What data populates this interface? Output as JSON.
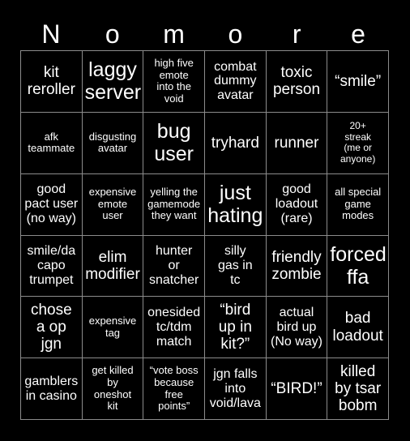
{
  "card": {
    "title_letters": [
      "N",
      "o",
      "m",
      "o",
      "r",
      "e"
    ],
    "columns": 6,
    "rows": 6,
    "colors": {
      "background": "#000000",
      "text": "#ffffff",
      "grid_line": "#8c8c8c"
    },
    "cells": [
      {
        "text": "kit\nreroller",
        "size": "lg"
      },
      {
        "text": "laggy\nserver",
        "size": "xl"
      },
      {
        "text": "high five\nemote\ninto the\nvoid",
        "size": "sm"
      },
      {
        "text": "combat\ndummy\navatar",
        "size": "md"
      },
      {
        "text": "toxic\nperson",
        "size": "lg"
      },
      {
        "text": "“smile”",
        "size": "lg"
      },
      {
        "text": "afk\nteammate",
        "size": "sm"
      },
      {
        "text": "disgusting\navatar",
        "size": "sm"
      },
      {
        "text": "bug\nuser",
        "size": "xl"
      },
      {
        "text": "tryhard",
        "size": "lg"
      },
      {
        "text": "runner",
        "size": "lg"
      },
      {
        "text": "20+\nstreak\n(me or\nanyone)",
        "size": "xs"
      },
      {
        "text": "good\npact user\n(no way)",
        "size": "md"
      },
      {
        "text": "expensive\nemote\nuser",
        "size": "sm"
      },
      {
        "text": "yelling the\ngamemode\nthey want",
        "size": "sm"
      },
      {
        "text": "just\nhating",
        "size": "xl"
      },
      {
        "text": "good\nloadout\n(rare)",
        "size": "md"
      },
      {
        "text": "all special\ngame\nmodes",
        "size": "sm"
      },
      {
        "text": "smile/da\ncapo\ntrumpet",
        "size": "md"
      },
      {
        "text": "elim\nmodifier",
        "size": "lg"
      },
      {
        "text": "hunter\nor\nsnatcher",
        "size": "md"
      },
      {
        "text": "silly\ngas in\ntc",
        "size": "md"
      },
      {
        "text": "friendly\nzombie",
        "size": "lg"
      },
      {
        "text": "forced\nffa",
        "size": "xl"
      },
      {
        "text": "chose\na op\njgn",
        "size": "lg"
      },
      {
        "text": "expensive\ntag",
        "size": "sm"
      },
      {
        "text": "onesided\ntc/tdm\nmatch",
        "size": "md"
      },
      {
        "text": "“bird\nup in\nkit?”",
        "size": "lg"
      },
      {
        "text": "actual\nbird up\n(No way)",
        "size": "md"
      },
      {
        "text": "bad\nloadout",
        "size": "lg"
      },
      {
        "text": "gamblers\nin casino",
        "size": "md"
      },
      {
        "text": "get killed\nby\noneshot\nkit",
        "size": "sm"
      },
      {
        "text": "“vote boss\nbecause\nfree\npoints”",
        "size": "sm"
      },
      {
        "text": "jgn falls\ninto\nvoid/lava",
        "size": "md"
      },
      {
        "text": "“BIRD!”",
        "size": "lg"
      },
      {
        "text": "killed\nby tsar\nbobm",
        "size": "lg"
      }
    ]
  }
}
